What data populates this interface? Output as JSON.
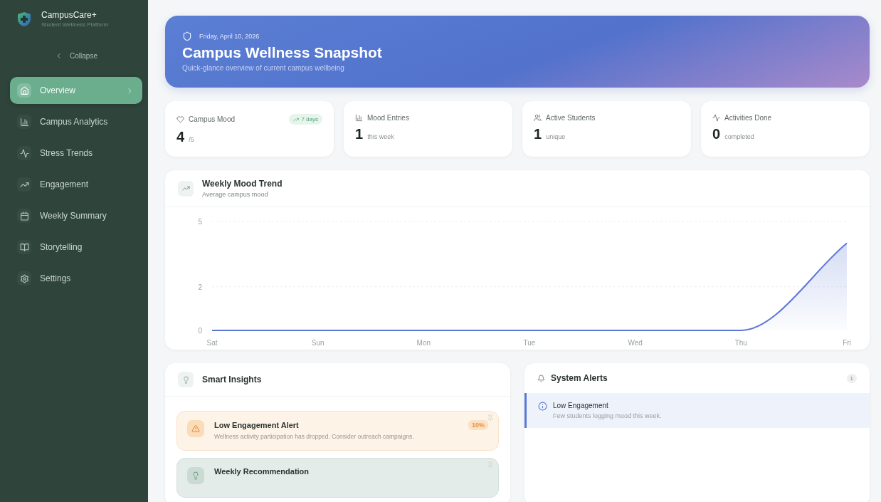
{
  "brand": {
    "name": "CampusCare+",
    "tagline": "Student Wellness Platform"
  },
  "collapse": {
    "label": "Collapse"
  },
  "nav": [
    {
      "label": "Overview",
      "selected": true
    },
    {
      "label": "Campus Analytics",
      "selected": false
    },
    {
      "label": "Stress Trends",
      "selected": false
    },
    {
      "label": "Engagement",
      "selected": false
    },
    {
      "label": "Weekly Summary",
      "selected": false
    },
    {
      "label": "Storytelling",
      "selected": false
    },
    {
      "label": "Settings",
      "selected": false
    }
  ],
  "hero": {
    "date": "Friday, April 10, 2026",
    "title": "Campus Wellness Snapshot",
    "subtitle": "Quick-glance overview of current campus wellbeing"
  },
  "stats": [
    {
      "label": "Campus Mood",
      "value": "4",
      "unit": "/5",
      "badge": "7 days"
    },
    {
      "label": "Mood Entries",
      "value": "1",
      "unit": "this week"
    },
    {
      "label": "Active Students",
      "value": "1",
      "unit": "unique"
    },
    {
      "label": "Activities Done",
      "value": "0",
      "unit": "completed"
    }
  ],
  "trend": {
    "title": "Weekly Mood Trend",
    "subtitle": "Average campus mood",
    "chart_data": {
      "type": "area",
      "categories": [
        "Sat",
        "Sun",
        "Mon",
        "Tue",
        "Wed",
        "Thu",
        "Fri"
      ],
      "series": [
        {
          "color": "#5b78d6",
          "values": [
            0,
            0,
            0,
            0,
            0,
            0,
            4
          ]
        }
      ],
      "ylim": [
        0,
        5
      ],
      "yticks": [
        0,
        2,
        5
      ]
    }
  },
  "insights": {
    "title": "Smart Insights",
    "items": [
      {
        "kind": "warning",
        "title": "Low Engagement Alert",
        "text": "Wellness activity participation has dropped. Consider outreach campaigns.",
        "badge": "10%"
      },
      {
        "kind": "recommendation",
        "title": "Weekly Recommendation"
      }
    ]
  },
  "alerts": {
    "title": "System Alerts",
    "count": "1",
    "items": [
      {
        "title": "Low Engagement",
        "text": "Few students logging mood this week."
      }
    ]
  }
}
